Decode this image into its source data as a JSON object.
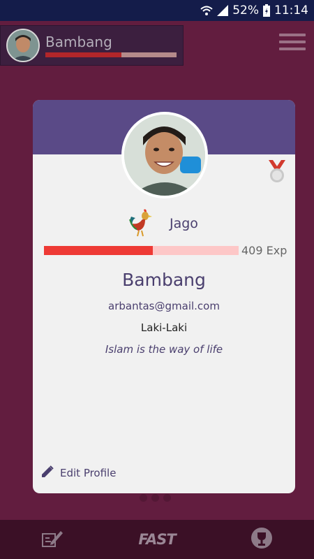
{
  "status_bar": {
    "battery": "52%",
    "time": "11:14"
  },
  "top_user": {
    "name": "Bambang",
    "progress": 0.58
  },
  "card": {
    "rank_name": "Jago",
    "exp_text": "409 Exp",
    "exp_progress": 0.56,
    "name": "Bambang",
    "email": "arbantas@gmail.com",
    "gender": "Laki-Laki",
    "motto": "Islam is the way of life",
    "edit_label": "Edit Profile"
  },
  "bottom_nav": {
    "center_label": "FAST"
  },
  "icons": [
    "wifi-icon",
    "signal-icon",
    "battery-icon",
    "menu-icon",
    "medal-icon",
    "rooster-icon",
    "pencil-icon",
    "quiz-icon",
    "trophy-icon"
  ],
  "colors": {
    "background": "#621d3f",
    "header": "#5a4a87",
    "accent": "#ee3a35",
    "text": "#4a3f6e"
  }
}
